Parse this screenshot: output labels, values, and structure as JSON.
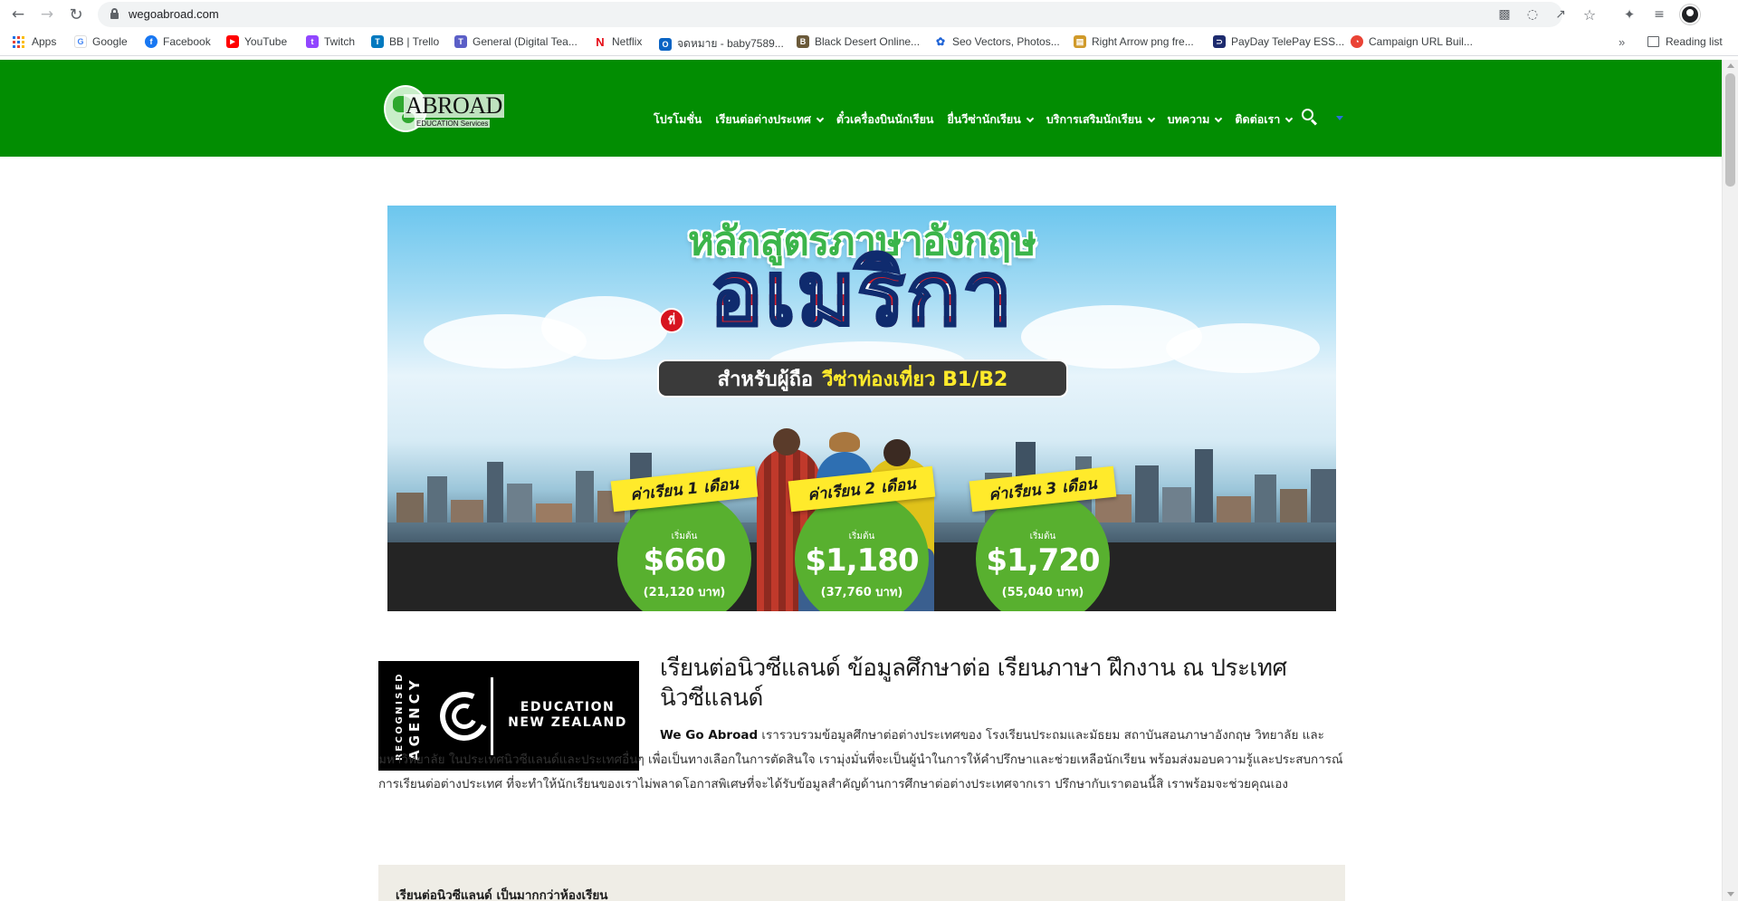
{
  "browser": {
    "url": "wegoabroad.com",
    "bookmarks": [
      {
        "label": "Apps"
      },
      {
        "label": "Google",
        "color": "#4285f4",
        "glyph": "G"
      },
      {
        "label": "Facebook",
        "color": "#1877f2",
        "glyph": "f"
      },
      {
        "label": "YouTube",
        "color": "#ff0000",
        "glyph": "▶"
      },
      {
        "label": "Twitch",
        "color": "#9146ff",
        "glyph": "t"
      },
      {
        "label": "BB | Trello",
        "color": "#0079bf",
        "glyph": "T"
      },
      {
        "label": "General (Digital Tea...",
        "color": "#5b5fc7",
        "glyph": "T"
      },
      {
        "label": "Netflix",
        "color": "#e50914",
        "glyph": "N"
      },
      {
        "label": "จดหมาย - baby7589...",
        "color": "#0a64c4",
        "glyph": "O"
      },
      {
        "label": "Black Desert Online...",
        "color": "#6b5a3a",
        "glyph": "B"
      },
      {
        "label": "Seo Vectors, Photos...",
        "color": "#1e63d6",
        "glyph": "✿"
      },
      {
        "label": "Right Arrow png fre...",
        "color": "#d09a2a",
        "glyph": "▤"
      },
      {
        "label": "PayDay TelePay ESS...",
        "color": "#1d2b6e",
        "glyph": "⊃"
      },
      {
        "label": "Campaign URL Buil...",
        "color": "#ea4335",
        "glyph": "◔"
      }
    ],
    "reading_list": "Reading list",
    "more_bookmarks": "»"
  },
  "site": {
    "logo": {
      "word": "ABROAD",
      "sub": "EDUCATION Services"
    },
    "nav": [
      {
        "label": "โปรโมชั่น",
        "dropdown": false
      },
      {
        "label": "เรียนต่อต่างประเทศ",
        "dropdown": true
      },
      {
        "label": "ตั๋วเครื่องบินนักเรียน",
        "dropdown": false
      },
      {
        "label": "ยื่นวีซ่านักเรียน",
        "dropdown": true
      },
      {
        "label": "บริการเสริมนักเรียน",
        "dropdown": true
      },
      {
        "label": "บทความ",
        "dropdown": true
      },
      {
        "label": "ติดต่อเรา",
        "dropdown": true
      }
    ],
    "colors": {
      "header": "#028d02",
      "price_circle": "#58b02f",
      "tag": "#ffea2b"
    }
  },
  "hero": {
    "title": "หลักสูตรภาษาอังกฤษ",
    "at": "ที่",
    "country": "อเมริกา",
    "visa_prefix": "สำหรับผู้ถือ",
    "visa_highlight": "วีซ่าท่องเที่ยว B1/B2",
    "prices": [
      {
        "label": "ค่าเรียน 1 เดือน",
        "from": "เริ่มต้น",
        "amount": "$660",
        "baht": "(21,120 บาท)"
      },
      {
        "label": "ค่าเรียน 2 เดือน",
        "from": "เริ่มต้น",
        "amount": "$1,180",
        "baht": "(37,760 บาท)"
      },
      {
        "label": "ค่าเรียน 3 เดือน",
        "from": "เริ่มต้น",
        "amount": "$1,720",
        "baht": "(55,040 บาท)"
      }
    ]
  },
  "agency": {
    "recognised": "RECOGNISED",
    "agency": "AGENCY",
    "line1": "EDUCATION",
    "line2": "NEW ZEALAND"
  },
  "intro": {
    "title": "เรียนต่อนิวซีแลนด์ ข้อมูลศึกษาต่อ เรียนภาษา ฝึกงาน ณ ประเทศนิวซีแลนด์",
    "brand": "We Go Abroad",
    "body": " เรารวบรวมข้อมูลศึกษาต่อต่างประเทศของ โรงเรียนประถมและมัธยม สถาบันสอนภาษาอังกฤษ วิทยาลัย และมหาวิทยาลัย ในประเทศนิวซีแลนด์และประเทศอื่นๆ เพื่อเป็นทางเลือกในการตัดสินใจ เรามุ่งมั่นที่จะเป็นผู้นำในการให้คำปรึกษาและช่วยเหลือนักเรียน พร้อมส่งมอบความรู้และประสบการณ์การเรียนต่อต่างประเทศ ที่จะทำให้นักเรียนของเราไม่พลาดโอกาสพิเศษที่จะได้รับข้อมูลสำคัญด้านการศึกษาต่อต่างประเทศจากเรา ปรึกษากับเราตอนนี้สิ เราพร้อมจะช่วยคุณเอง"
  },
  "section2": {
    "title": "เรียนต่อนิวซีแลนด์ เป็นมากกว่าห้องเรียน"
  }
}
